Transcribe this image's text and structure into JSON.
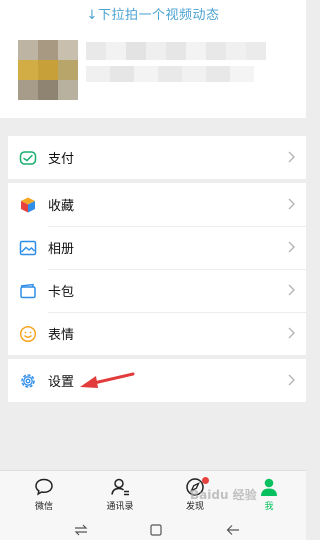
{
  "pull_hint": "↓下拉拍一个视频动态",
  "menu": {
    "pay": "支付",
    "favorites": "收藏",
    "album": "相册",
    "cards": "卡包",
    "stickers": "表情",
    "settings": "设置"
  },
  "tabs": [
    "微信",
    "通讯录",
    "发现",
    "我"
  ],
  "colors": {
    "accent": "#07c160",
    "hint": "#4da3d4",
    "annotation_arrow": "#e23b3b",
    "badge": "#e64340"
  },
  "watermark": "Baidu 经验"
}
